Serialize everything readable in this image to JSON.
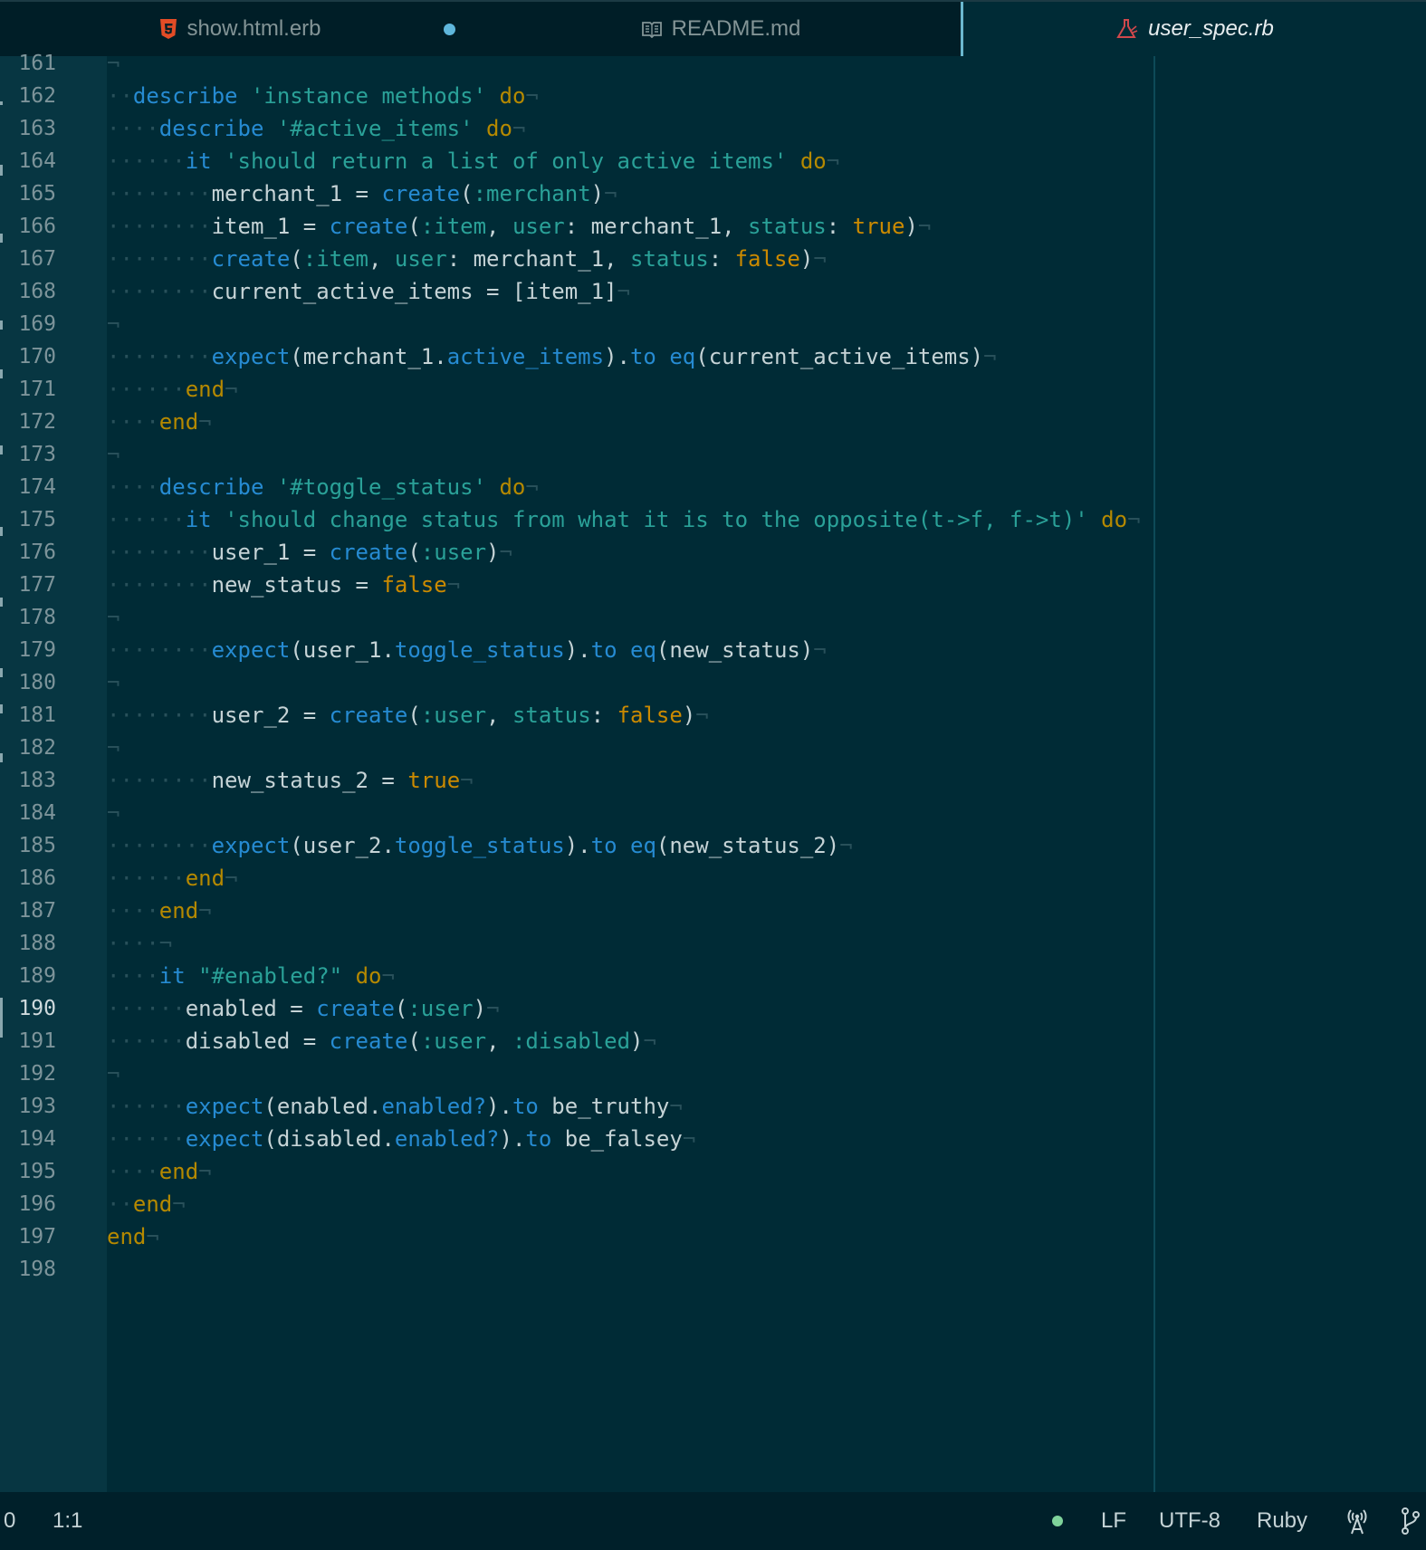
{
  "tabs": [
    {
      "label": "show.html.erb",
      "icon": "html5-icon",
      "modified": true
    },
    {
      "label": "README.md",
      "icon": "book-icon",
      "modified": false
    },
    {
      "label": "user_spec.rb",
      "icon": "flask-icon",
      "active": true
    }
  ],
  "editor": {
    "current_line": "190",
    "lines": [
      {
        "n": "161",
        "indent": 0,
        "tokens": [
          [
            "inv",
            "¬"
          ]
        ]
      },
      {
        "n": "162",
        "indent": 1,
        "tokens": [
          [
            "kw",
            "describe"
          ],
          [
            "id",
            " "
          ],
          [
            "str",
            "'instance methods'"
          ],
          [
            "id",
            " "
          ],
          [
            "do",
            "do"
          ],
          [
            "inv",
            "¬"
          ]
        ]
      },
      {
        "n": "163",
        "indent": 2,
        "tokens": [
          [
            "kw",
            "describe"
          ],
          [
            "id",
            " "
          ],
          [
            "str",
            "'#active_items'"
          ],
          [
            "id",
            " "
          ],
          [
            "do",
            "do"
          ],
          [
            "inv",
            "¬"
          ]
        ]
      },
      {
        "n": "164",
        "indent": 3,
        "tokens": [
          [
            "kw",
            "it"
          ],
          [
            "id",
            " "
          ],
          [
            "str",
            "'should return a list of only active items'"
          ],
          [
            "id",
            " "
          ],
          [
            "do",
            "do"
          ],
          [
            "inv",
            "¬"
          ]
        ]
      },
      {
        "n": "165",
        "indent": 4,
        "tokens": [
          [
            "id",
            "merchant_1 = "
          ],
          [
            "kw",
            "create"
          ],
          [
            "id",
            "("
          ],
          [
            "sym",
            ":merchant"
          ],
          [
            "id",
            ")"
          ],
          [
            "inv",
            "¬"
          ]
        ]
      },
      {
        "n": "166",
        "indent": 4,
        "tokens": [
          [
            "id",
            "item_1 = "
          ],
          [
            "kw",
            "create"
          ],
          [
            "id",
            "("
          ],
          [
            "sym",
            ":item"
          ],
          [
            "id",
            ", "
          ],
          [
            "sym",
            "user"
          ],
          [
            "id",
            ": merchant_1, "
          ],
          [
            "sym",
            "status"
          ],
          [
            "id",
            ": "
          ],
          [
            "bool",
            "true"
          ],
          [
            "id",
            ")"
          ],
          [
            "inv",
            "¬"
          ]
        ]
      },
      {
        "n": "167",
        "indent": 4,
        "tokens": [
          [
            "kw",
            "create"
          ],
          [
            "id",
            "("
          ],
          [
            "sym",
            ":item"
          ],
          [
            "id",
            ", "
          ],
          [
            "sym",
            "user"
          ],
          [
            "id",
            ": merchant_1, "
          ],
          [
            "sym",
            "status"
          ],
          [
            "id",
            ": "
          ],
          [
            "bool",
            "false"
          ],
          [
            "id",
            ")"
          ],
          [
            "inv",
            "¬"
          ]
        ]
      },
      {
        "n": "168",
        "indent": 4,
        "tokens": [
          [
            "id",
            "current_active_items = [item_1]"
          ],
          [
            "inv",
            "¬"
          ]
        ]
      },
      {
        "n": "169",
        "indent": 0,
        "tokens": [
          [
            "inv",
            "¬"
          ]
        ]
      },
      {
        "n": "170",
        "indent": 4,
        "tokens": [
          [
            "kw",
            "expect"
          ],
          [
            "id",
            "(merchant_1."
          ],
          [
            "kw",
            "active_items"
          ],
          [
            "id",
            ")."
          ],
          [
            "kw",
            "to"
          ],
          [
            "id",
            " "
          ],
          [
            "kw",
            "eq"
          ],
          [
            "id",
            "(current_active_items)"
          ],
          [
            "inv",
            "¬"
          ]
        ]
      },
      {
        "n": "171",
        "indent": 3,
        "tokens": [
          [
            "do",
            "end"
          ],
          [
            "inv",
            "¬"
          ]
        ]
      },
      {
        "n": "172",
        "indent": 2,
        "tokens": [
          [
            "do",
            "end"
          ],
          [
            "inv",
            "¬"
          ]
        ]
      },
      {
        "n": "173",
        "indent": 0,
        "tokens": [
          [
            "inv",
            "¬"
          ]
        ]
      },
      {
        "n": "174",
        "indent": 2,
        "tokens": [
          [
            "kw",
            "describe"
          ],
          [
            "id",
            " "
          ],
          [
            "str",
            "'#toggle_status'"
          ],
          [
            "id",
            " "
          ],
          [
            "do",
            "do"
          ],
          [
            "inv",
            "¬"
          ]
        ]
      },
      {
        "n": "175",
        "indent": 3,
        "tokens": [
          [
            "kw",
            "it"
          ],
          [
            "id",
            " "
          ],
          [
            "str",
            "'should change status from what it is to the opposite(t->f, f->t)'"
          ],
          [
            "id",
            " "
          ],
          [
            "do",
            "do"
          ],
          [
            "inv",
            "¬"
          ]
        ]
      },
      {
        "n": "176",
        "indent": 4,
        "tokens": [
          [
            "id",
            "user_1 = "
          ],
          [
            "kw",
            "create"
          ],
          [
            "id",
            "("
          ],
          [
            "sym",
            ":user"
          ],
          [
            "id",
            ")"
          ],
          [
            "inv",
            "¬"
          ]
        ]
      },
      {
        "n": "177",
        "indent": 4,
        "tokens": [
          [
            "id",
            "new_status = "
          ],
          [
            "bool",
            "false"
          ],
          [
            "inv",
            "¬"
          ]
        ]
      },
      {
        "n": "178",
        "indent": 0,
        "tokens": [
          [
            "inv",
            "¬"
          ]
        ]
      },
      {
        "n": "179",
        "indent": 4,
        "tokens": [
          [
            "kw",
            "expect"
          ],
          [
            "id",
            "(user_1."
          ],
          [
            "kw",
            "toggle_status"
          ],
          [
            "id",
            ")."
          ],
          [
            "kw",
            "to"
          ],
          [
            "id",
            " "
          ],
          [
            "kw",
            "eq"
          ],
          [
            "id",
            "(new_status)"
          ],
          [
            "inv",
            "¬"
          ]
        ]
      },
      {
        "n": "180",
        "indent": 0,
        "tokens": [
          [
            "inv",
            "¬"
          ]
        ]
      },
      {
        "n": "181",
        "indent": 4,
        "tokens": [
          [
            "id",
            "user_2 = "
          ],
          [
            "kw",
            "create"
          ],
          [
            "id",
            "("
          ],
          [
            "sym",
            ":user"
          ],
          [
            "id",
            ", "
          ],
          [
            "sym",
            "status"
          ],
          [
            "id",
            ": "
          ],
          [
            "bool",
            "false"
          ],
          [
            "id",
            ")"
          ],
          [
            "inv",
            "¬"
          ]
        ]
      },
      {
        "n": "182",
        "indent": 0,
        "tokens": [
          [
            "inv",
            "¬"
          ]
        ]
      },
      {
        "n": "183",
        "indent": 4,
        "tokens": [
          [
            "id",
            "new_status_2 = "
          ],
          [
            "bool",
            "true"
          ],
          [
            "inv",
            "¬"
          ]
        ]
      },
      {
        "n": "184",
        "indent": 0,
        "tokens": [
          [
            "inv",
            "¬"
          ]
        ]
      },
      {
        "n": "185",
        "indent": 4,
        "tokens": [
          [
            "kw",
            "expect"
          ],
          [
            "id",
            "(user_2."
          ],
          [
            "kw",
            "toggle_status"
          ],
          [
            "id",
            ")."
          ],
          [
            "kw",
            "to"
          ],
          [
            "id",
            " "
          ],
          [
            "kw",
            "eq"
          ],
          [
            "id",
            "(new_status_2)"
          ],
          [
            "inv",
            "¬"
          ]
        ]
      },
      {
        "n": "186",
        "indent": 3,
        "tokens": [
          [
            "do",
            "end"
          ],
          [
            "inv",
            "¬"
          ]
        ]
      },
      {
        "n": "187",
        "indent": 2,
        "tokens": [
          [
            "do",
            "end"
          ],
          [
            "inv",
            "¬"
          ]
        ]
      },
      {
        "n": "188",
        "indent": 2,
        "tokens": [
          [
            "inv",
            "¬"
          ]
        ]
      },
      {
        "n": "189",
        "indent": 2,
        "tokens": [
          [
            "kw",
            "it"
          ],
          [
            "id",
            " "
          ],
          [
            "str",
            "\"#enabled?\""
          ],
          [
            "id",
            " "
          ],
          [
            "do",
            "do"
          ],
          [
            "inv",
            "¬"
          ]
        ]
      },
      {
        "n": "190",
        "indent": 3,
        "tokens": [
          [
            "id",
            "enabled = "
          ],
          [
            "kw",
            "create"
          ],
          [
            "id",
            "("
          ],
          [
            "sym",
            ":user"
          ],
          [
            "id",
            ")"
          ],
          [
            "inv",
            "¬"
          ]
        ]
      },
      {
        "n": "191",
        "indent": 3,
        "tokens": [
          [
            "id",
            "disabled = "
          ],
          [
            "kw",
            "create"
          ],
          [
            "id",
            "("
          ],
          [
            "sym",
            ":user"
          ],
          [
            "id",
            ", "
          ],
          [
            "sym",
            ":disabled"
          ],
          [
            "id",
            ")"
          ],
          [
            "inv",
            "¬"
          ]
        ]
      },
      {
        "n": "192",
        "indent": 0,
        "tokens": [
          [
            "inv",
            "¬"
          ]
        ]
      },
      {
        "n": "193",
        "indent": 3,
        "tokens": [
          [
            "kw",
            "expect"
          ],
          [
            "id",
            "(enabled."
          ],
          [
            "kw",
            "enabled?"
          ],
          [
            "id",
            ")."
          ],
          [
            "kw",
            "to"
          ],
          [
            "id",
            " be_truthy"
          ],
          [
            "inv",
            "¬"
          ]
        ]
      },
      {
        "n": "194",
        "indent": 3,
        "tokens": [
          [
            "kw",
            "expect"
          ],
          [
            "id",
            "(disabled."
          ],
          [
            "kw",
            "enabled?"
          ],
          [
            "id",
            ")."
          ],
          [
            "kw",
            "to"
          ],
          [
            "id",
            " be_falsey"
          ],
          [
            "inv",
            "¬"
          ]
        ]
      },
      {
        "n": "195",
        "indent": 2,
        "tokens": [
          [
            "do",
            "end"
          ],
          [
            "inv",
            "¬"
          ]
        ]
      },
      {
        "n": "196",
        "indent": 1,
        "tokens": [
          [
            "do",
            "end"
          ],
          [
            "inv",
            "¬"
          ]
        ]
      },
      {
        "n": "197",
        "indent": 0,
        "tokens": [
          [
            "do",
            "end"
          ],
          [
            "inv",
            "¬"
          ]
        ]
      },
      {
        "n": "198",
        "indent": 0,
        "tokens": []
      }
    ]
  },
  "status_bar": {
    "left_count": "0",
    "cursor_position": "1:1",
    "line_ending": "LF",
    "encoding": "UTF-8",
    "grammar": "Ruby",
    "git_status_color": "#7fd39b"
  },
  "colors": {
    "background": "#002b36",
    "gutter": "#073642",
    "keyword": "#268bd2",
    "string": "#2aa198",
    "do_end": "#b58900",
    "boolean": "#cb8a00"
  }
}
